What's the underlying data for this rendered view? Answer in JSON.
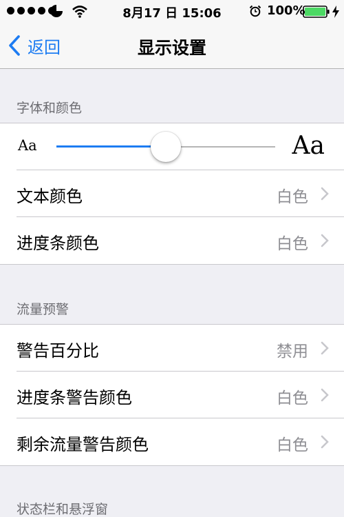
{
  "status_bar": {
    "time": "8月17 日 15:06",
    "battery_percent": "100%",
    "battery_level": 1.0,
    "signal_dots": 5,
    "battery_color": "#4cd964"
  },
  "nav": {
    "back_label": "返回",
    "title": "显示设置",
    "accent_color": "#1d7cf2"
  },
  "sections": {
    "font_color": {
      "header": "字体和颜色",
      "slider": {
        "small_label": "Aa",
        "large_label": "Aa",
        "value": 0.5
      },
      "text_color": {
        "label": "文本颜色",
        "value": "白色"
      },
      "progress_color": {
        "label": "进度条颜色",
        "value": "白色"
      }
    },
    "traffic_warning": {
      "header": "流量预警",
      "warning_percent": {
        "label": "警告百分比",
        "value": "禁用"
      },
      "progress_warning_color": {
        "label": "进度条警告颜色",
        "value": "白色"
      },
      "remaining_warning_color": {
        "label": "剩余流量警告颜色",
        "value": "白色"
      }
    },
    "statusbar_float": {
      "header": "状态栏和悬浮窗"
    }
  }
}
